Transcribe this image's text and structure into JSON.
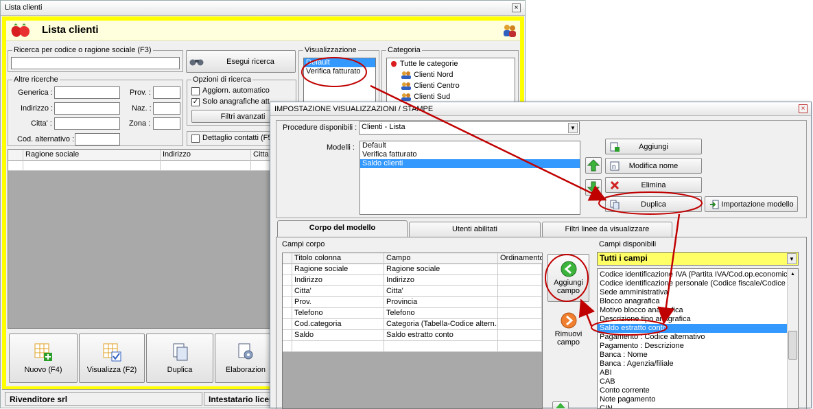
{
  "main_window": {
    "title": "Lista clienti",
    "header_title": "Lista clienti",
    "search": {
      "legend": "Ricerca per codice o ragione sociale (F3)",
      "value": "",
      "button": "Esegui ricerca"
    },
    "other_searches": {
      "legend": "Altre ricerche",
      "generica": "Generica :",
      "indirizzo": "Indirizzo :",
      "citta": "Citta' :",
      "cod_alternativo": "Cod. alternativo :",
      "prov": "Prov. :",
      "naz": "Naz. :",
      "zona": "Zona :"
    },
    "search_options": {
      "legend": "Opzioni di ricerca",
      "auto_update": "Aggiorn. automatico",
      "auto_update_checked": false,
      "only_active": "Solo anagrafiche att",
      "only_active_checked": true,
      "advanced_filters": "Filtri avanzati"
    },
    "contact_detail": {
      "label": "Dettaglio contatti (F5",
      "checked": false
    },
    "view": {
      "legend": "Visualizzazione",
      "items": [
        "Default",
        "Verifica fatturato"
      ],
      "selected": 0
    },
    "category": {
      "legend": "Categoria",
      "root": "Tutte le categorie",
      "items": [
        "Clienti Nord",
        "Clienti Centro",
        "Clienti Sud"
      ]
    },
    "grid_columns": [
      "Ragione sociale",
      "Indirizzo",
      "Citta"
    ],
    "bottom_buttons": {
      "nuovo": "Nuovo (F4)",
      "visualizza": "Visualizza (F2)",
      "duplica": "Duplica",
      "elaborazioni": "Elaborazion"
    },
    "status_bar": {
      "left": "Rivenditore srl",
      "right": "Intestatario licen"
    }
  },
  "dialog": {
    "title": "IMPOSTAZIONE VISUALIZZAZIONI / STAMPE",
    "procedures_label": "Procedure disponibili :",
    "procedures_value": "Clienti - Lista",
    "models_label": "Modelli :",
    "models": [
      "Default",
      "Verifica fatturato",
      "Saldo clienti"
    ],
    "models_selected": 2,
    "buttons": {
      "aggiungi": "Aggiungi",
      "modifica_nome": "Modifica nome",
      "elimina": "Elimina",
      "duplica": "Duplica",
      "importazione": "Importazione modello"
    },
    "tabs": [
      "Corpo del modello",
      "Utenti abilitati",
      "Filtri linee da visualizzare"
    ],
    "active_tab": 0,
    "body_fields_label": "Campi corpo",
    "body_columns": [
      "Titolo colonna",
      "Campo",
      "Ordinamento"
    ],
    "body_rows": [
      [
        "Ragione sociale",
        "Ragione sociale",
        ""
      ],
      [
        "Indirizzo",
        "Indirizzo",
        ""
      ],
      [
        "Citta'",
        "Citta'",
        ""
      ],
      [
        "Prov.",
        "Provincia",
        ""
      ],
      [
        "Telefono",
        "Telefono",
        ""
      ],
      [
        "Cod.categoria",
        "Categoria (Tabella-Codice altern...",
        ""
      ],
      [
        "Saldo",
        "Saldo estratto conto",
        ""
      ]
    ],
    "add_field": "Aggiungi campo",
    "remove_field": "Rimuovi campo",
    "available_label": "Campi disponibili",
    "available_filter": "Tutti i campi",
    "available_fields": [
      "Codice identificazione IVA (Partita IVA/Cod.op.economico",
      "Codice identificazione personale (Codice fiscale/Codice IS",
      "Sede amministrativa",
      "Blocco anagrafica",
      "Motivo blocco anagrafica",
      "Descrizione tipo anagrafica",
      "Saldo estratto conto",
      "Pagamento : Codice alternativo",
      "Pagamento : Descrizione",
      "Banca : Nome",
      "Banca : Agenzia/filiale",
      "ABI",
      "CAB",
      "Conto corrente",
      "Note pagamento",
      "CIN"
    ],
    "available_selected": 6
  },
  "colors": {
    "yellow": "#ffff00",
    "header_yellow": "#ffffcc",
    "selection": "#3399ff",
    "annotation_red": "#c00000",
    "field_filter_yellow": "#ffff66"
  }
}
